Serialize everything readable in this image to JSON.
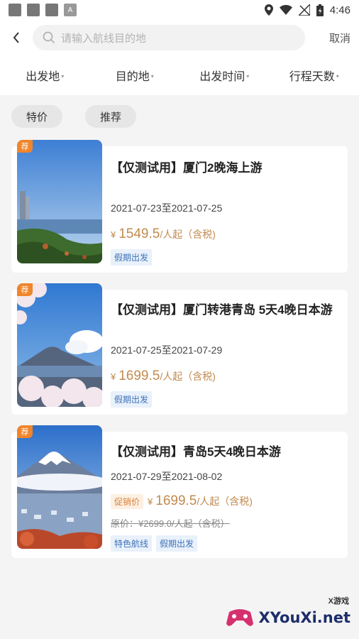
{
  "status": {
    "time": "4:46"
  },
  "search": {
    "placeholder": "请输入航线目的地",
    "cancel": "取消"
  },
  "filters": [
    {
      "label": "出发地"
    },
    {
      "label": "目的地"
    },
    {
      "label": "出发时间"
    },
    {
      "label": "行程天数"
    }
  ],
  "chips": [
    {
      "label": "特价"
    },
    {
      "label": "推荐"
    }
  ],
  "items": [
    {
      "tag": "荐",
      "title": "【仅测试用】厦门2晚海上游",
      "dates": "2021-07-23至2021-07-25",
      "currency": "¥",
      "price": "1549.5",
      "price_suffix": "/人起（含税)",
      "labels": [
        "假期出发"
      ]
    },
    {
      "tag": "荐",
      "title": "【仅测试用】厦门转港青岛 5天4晚日本游",
      "dates": "2021-07-25至2021-07-29",
      "currency": "¥",
      "price": "1699.5",
      "price_suffix": "/人起（含税)",
      "labels": [
        "假期出发"
      ]
    },
    {
      "tag": "荐",
      "title": "【仅测试用】青岛5天4晚日本游",
      "dates": "2021-07-29至2021-08-02",
      "promo": "促销价",
      "currency": "¥",
      "price": "1699.5",
      "price_suffix": "/人起（含税)",
      "original": "原价：¥2699.0/人起（含税）",
      "labels": [
        "特色航线",
        "假期出发"
      ]
    }
  ],
  "watermark": {
    "text": "XYouXi.net",
    "small": "X游戏"
  }
}
